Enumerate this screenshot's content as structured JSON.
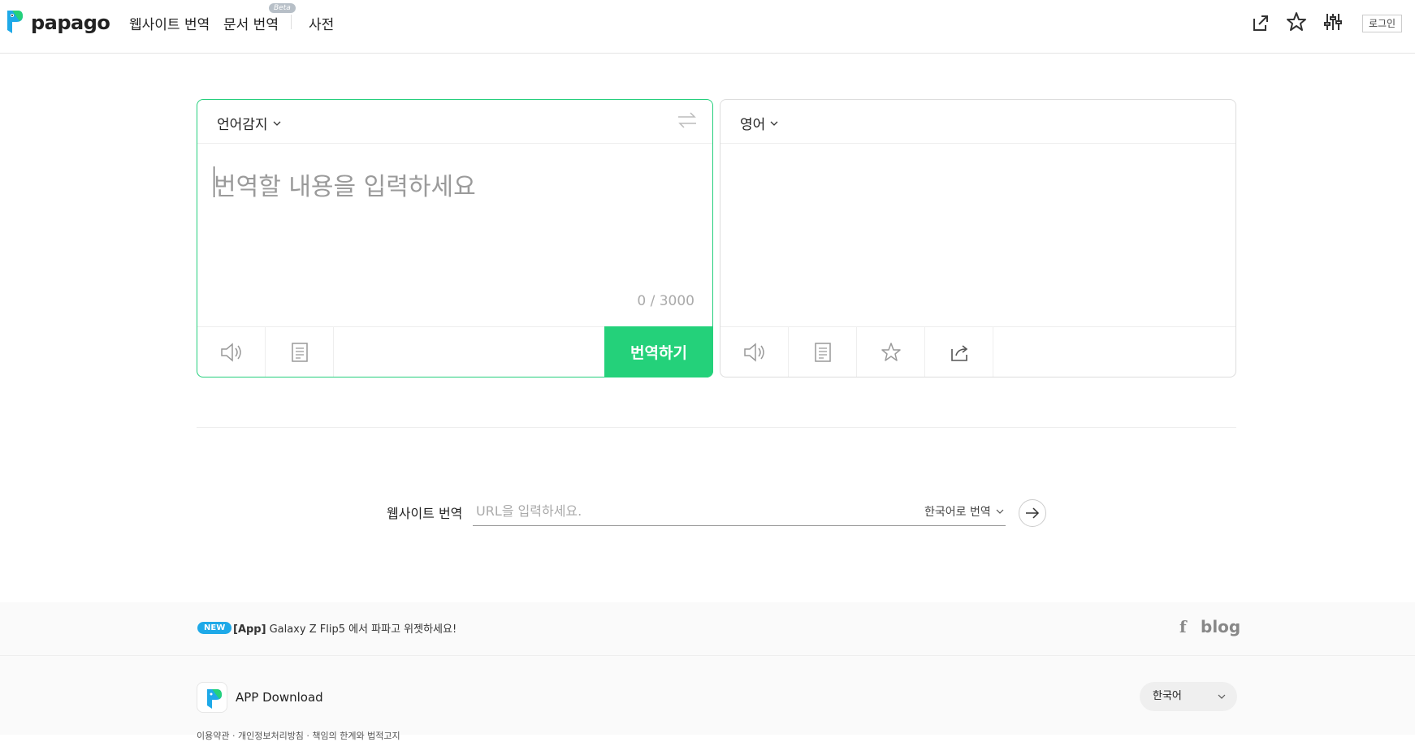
{
  "header": {
    "logo_text": "papago",
    "nav": [
      {
        "label": "웹사이트 번역"
      },
      {
        "label": "문서 번역"
      },
      {
        "label": "사전"
      }
    ],
    "beta_label": "Beta",
    "login_label": "로그인"
  },
  "source": {
    "language": "언어감지",
    "placeholder": "번역할 내용을 입력하세요",
    "counter": "0 / 3000",
    "translate_label": "번역하기"
  },
  "target": {
    "language": "영어"
  },
  "website": {
    "label": "웹사이트 번역",
    "placeholder": "URL을 입력하세요.",
    "target_lang": "한국어로 번역"
  },
  "footer": {
    "news_badge": "NEW",
    "news_prefix": "[App]",
    "news_text": "Galaxy Z Flip5 에서 파파고 위젯하세요!",
    "facebook": "f",
    "blog": "blog",
    "app_download": "APP Download",
    "language": "한국어",
    "links": "이용약관 · 개인정보처리방침 · 책임의 한계와 법적고지"
  },
  "colors": {
    "accent": "#24d17a",
    "badge": "#1ea9e8"
  }
}
